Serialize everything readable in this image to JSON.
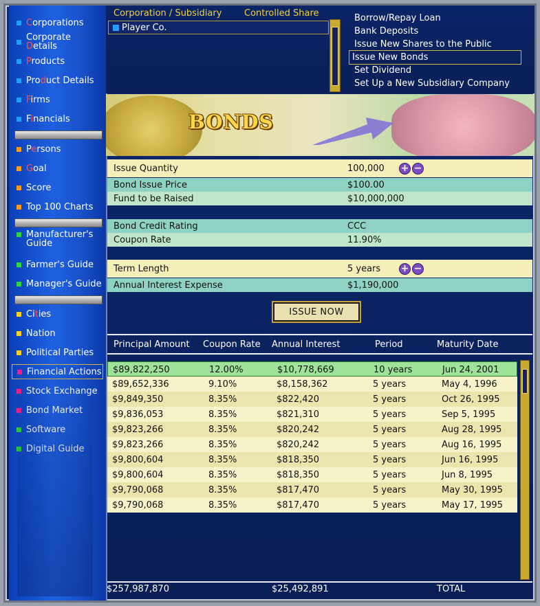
{
  "sidebar": {
    "items": [
      {
        "pre": "",
        "hl": "C",
        "post": "orporations",
        "color": "#1ea0ff"
      },
      {
        "pre": "Corporate ",
        "hl": "D",
        "post": "etails",
        "color": "#1ea0ff"
      },
      {
        "pre": "",
        "hl": "P",
        "post": "roducts",
        "color": "#1ea0ff"
      },
      {
        "pre": "Pro",
        "hl": "d",
        "post": "uct Details",
        "color": "#1ea0ff"
      },
      {
        "pre": "",
        "hl": "F",
        "post": "irms",
        "color": "#1ea0ff"
      },
      {
        "pre": "F",
        "hl": "i",
        "post": "nancials",
        "color": "#1ea0ff"
      },
      {
        "pre": "P",
        "hl": "e",
        "post": "rsons",
        "color": "#ff9c1a"
      },
      {
        "pre": "",
        "hl": "G",
        "post": "oal",
        "color": "#ff9c1a"
      },
      {
        "pre": "Score",
        "hl": "",
        "post": "",
        "color": "#ff9c1a"
      },
      {
        "pre": "Top 100 Charts",
        "hl": "",
        "post": "",
        "color": "#ff9c1a"
      },
      {
        "pre": "Manufacturer's",
        "hl": "",
        "post": "",
        "pre2": "Guide",
        "color": "#2cd93c"
      },
      {
        "pre": "Farmer's Guide",
        "hl": "",
        "post": "",
        "color": "#2cd93c"
      },
      {
        "pre": "Manager's Guide",
        "hl": "",
        "post": "",
        "color": "#2cd93c"
      },
      {
        "pre": "Ci",
        "hl": "t",
        "post": "ies",
        "color": "#ffd21e"
      },
      {
        "pre": "Nation",
        "hl": "",
        "post": "",
        "color": "#ffd21e"
      },
      {
        "pre": "Political Parties",
        "hl": "",
        "post": "",
        "color": "#ffd21e"
      },
      {
        "pre": "Financial Actions",
        "hl": "",
        "post": "",
        "color": "#ff1e86"
      },
      {
        "pre": "Stock Exchange",
        "hl": "",
        "post": "",
        "color": "#ff1e86"
      },
      {
        "pre": "Bond Market",
        "hl": "",
        "post": "",
        "color": "#ff1e86"
      },
      {
        "pre": "Software",
        "hl": "",
        "post": "",
        "color": "#2cd93c"
      },
      {
        "pre": "Digital Guide",
        "hl": "",
        "post": "",
        "color": "#2cd93c"
      }
    ]
  },
  "corp": {
    "col1": "Corporation / Subsidiary",
    "col2": "Controlled Share",
    "row1": "Player Co."
  },
  "actions": [
    "Borrow/Repay Loan",
    "Bank Deposits",
    "Issue New Shares to the Public",
    "Issue New Bonds",
    "Set Dividend",
    "Set Up a New Subsidiary Company"
  ],
  "banner": {
    "title": "BONDS"
  },
  "form": {
    "issue_quantity": {
      "k": "Issue Quantity",
      "v": "100,000"
    },
    "bond_issue_price": {
      "k": "Bond Issue Price",
      "v": "$100.00"
    },
    "fund_to_raise": {
      "k": "Fund to be Raised",
      "v": "$10,000,000"
    },
    "credit_rating": {
      "k": "Bond Credit Rating",
      "v": "CCC"
    },
    "coupon_rate": {
      "k": "Coupon Rate",
      "v": "11.90%"
    },
    "term_length": {
      "k": "Term Length",
      "v": "5 years"
    },
    "annual_interest": {
      "k": "Annual Interest Expense",
      "v": "$1,190,000"
    },
    "plus": "+",
    "minus": "−"
  },
  "issue_button": "ISSUE NOW",
  "table": {
    "headers": [
      "Principal Amount",
      "Coupon Rate",
      "Annual Interest",
      "Period",
      "Maturity Date"
    ],
    "rows": [
      [
        "$89,822,250",
        "12.00%",
        "$10,778,669",
        "10 years",
        "Jun 24, 2001"
      ],
      [
        "$89,652,336",
        "9.10%",
        "$8,158,362",
        "5 years",
        "May 4, 1996"
      ],
      [
        "$9,849,350",
        "8.35%",
        "$822,420",
        "5 years",
        "Oct 26, 1995"
      ],
      [
        "$9,836,053",
        "8.35%",
        "$821,310",
        "5 years",
        "Sep 5, 1995"
      ],
      [
        "$9,823,266",
        "8.35%",
        "$820,242",
        "5 years",
        "Aug 28, 1995"
      ],
      [
        "$9,823,266",
        "8.35%",
        "$820,242",
        "5 years",
        "Aug 16, 1995"
      ],
      [
        "$9,800,604",
        "8.35%",
        "$818,350",
        "5 years",
        "Jun 16, 1995"
      ],
      [
        "$9,800,604",
        "8.35%",
        "$818,350",
        "5 years",
        "Jun 8, 1995"
      ],
      [
        "$9,790,068",
        "8.35%",
        "$817,470",
        "5 years",
        "May 30, 1995"
      ],
      [
        "$9,790,068",
        "8.35%",
        "$817,470",
        "5 years",
        "May 17, 1995"
      ]
    ]
  },
  "totals": {
    "principal": "$257,987,870",
    "interest": "$25,492,891",
    "label": "TOTAL"
  }
}
